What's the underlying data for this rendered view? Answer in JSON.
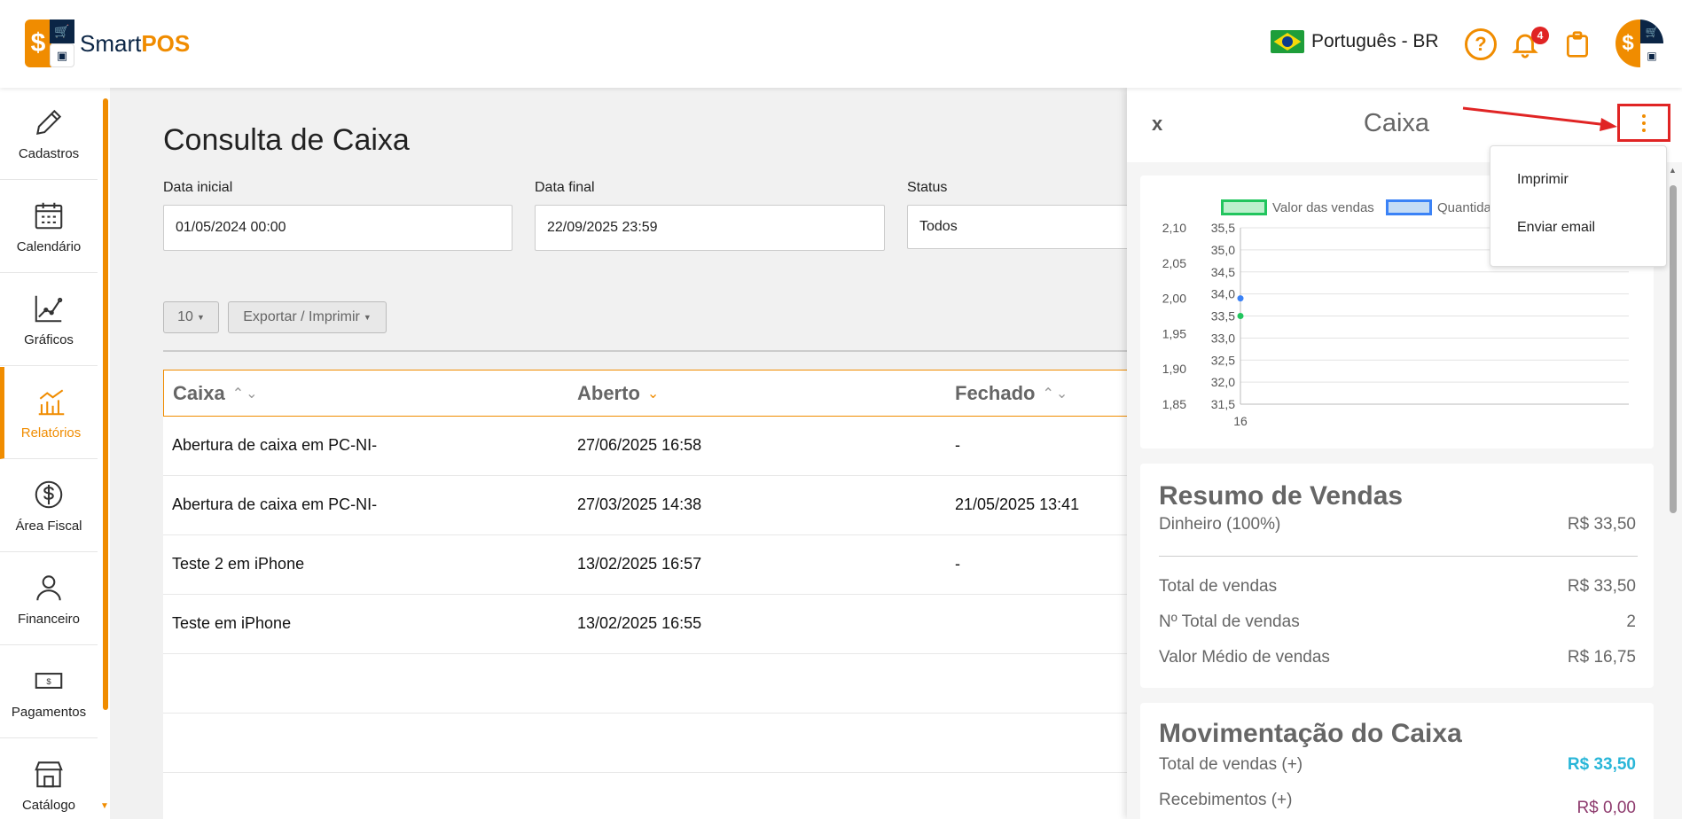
{
  "header": {
    "logo_text_a": "Smart",
    "logo_text_b": "POS",
    "language": "Português - BR",
    "notifications_count": "4",
    "help_glyph": "?"
  },
  "sidebar": {
    "items": [
      {
        "label": "Cadastros",
        "icon": "pencil-icon"
      },
      {
        "label": "Calendário",
        "icon": "calendar-icon"
      },
      {
        "label": "Gráficos",
        "icon": "line-chart-icon"
      },
      {
        "label": "Relatórios",
        "icon": "bar-chart-icon",
        "active": true
      },
      {
        "label": "Área Fiscal",
        "icon": "dollar-circle-icon"
      },
      {
        "label": "Financeiro",
        "icon": "person-icon"
      },
      {
        "label": "Pagamentos",
        "icon": "banknote-icon"
      },
      {
        "label": "Catálogo",
        "icon": "store-icon"
      }
    ]
  },
  "main": {
    "title": "Consulta de Caixa",
    "filters": {
      "start_label": "Data inicial",
      "start_value": "01/05/2024 00:00",
      "end_label": "Data final",
      "end_value": "22/09/2025 23:59",
      "status_label": "Status",
      "status_value": "Todos"
    },
    "page_size": "10",
    "export_label": "Exportar / Imprimir",
    "table": {
      "headers": [
        "Caixa",
        "Aberto",
        "Fechado"
      ],
      "rows": [
        [
          "Abertura de caixa em PC-NI-",
          "27/06/2025 16:58",
          "-"
        ],
        [
          "Abertura de caixa em PC-NI-",
          "27/03/2025 14:38",
          "21/05/2025 13:41"
        ],
        [
          "Teste 2 em iPhone",
          "13/02/2025 16:57",
          "-"
        ],
        [
          "Teste em iPhone",
          "13/02/2025 16:55",
          ""
        ]
      ]
    }
  },
  "panel": {
    "close_label": "x",
    "title": "Caixa",
    "menu": {
      "print_label": "Imprimir",
      "email_label": "Enviar email"
    },
    "chart_data": {
      "type": "line",
      "categories": [
        "16"
      ],
      "series": [
        {
          "name": "Valor das vendas",
          "values": [
            33.5
          ],
          "color": "#22c55e"
        },
        {
          "name": "Quantida",
          "values": [
            2
          ],
          "color": "#3b82f6"
        }
      ],
      "y_left_ticks": [
        "2,10",
        "2,05",
        "2,00",
        "1,95",
        "1,90",
        "1,85"
      ],
      "y_left_range": [
        1.85,
        2.1
      ],
      "y_right_ticks": [
        "35,5",
        "35,0",
        "34,5",
        "34,0",
        "33,5",
        "33,0",
        "32,5",
        "32,0",
        "31,5"
      ],
      "y_right_range": [
        31.5,
        35.5
      ],
      "legend_position": "top",
      "grid": true
    },
    "summary": {
      "title": "Resumo de Vendas",
      "cash_label": "Dinheiro (100%)",
      "cash_value": "R$ 33,50",
      "total_label": "Total de vendas",
      "total_value": "R$ 33,50",
      "count_label": "Nº Total de vendas",
      "count_value": "2",
      "avg_label": "Valor Médio de vendas",
      "avg_value": "R$ 16,75"
    },
    "movement": {
      "title": "Movimentação do Caixa",
      "sales_label": "Total de vendas (+)",
      "sales_value": "R$ 33,50",
      "sales_color": "#29b6d8",
      "receipts_label": "Recebimentos (+)",
      "receipts_value": "R$ 0,00",
      "receipts_color": "#8e3b6e"
    }
  }
}
